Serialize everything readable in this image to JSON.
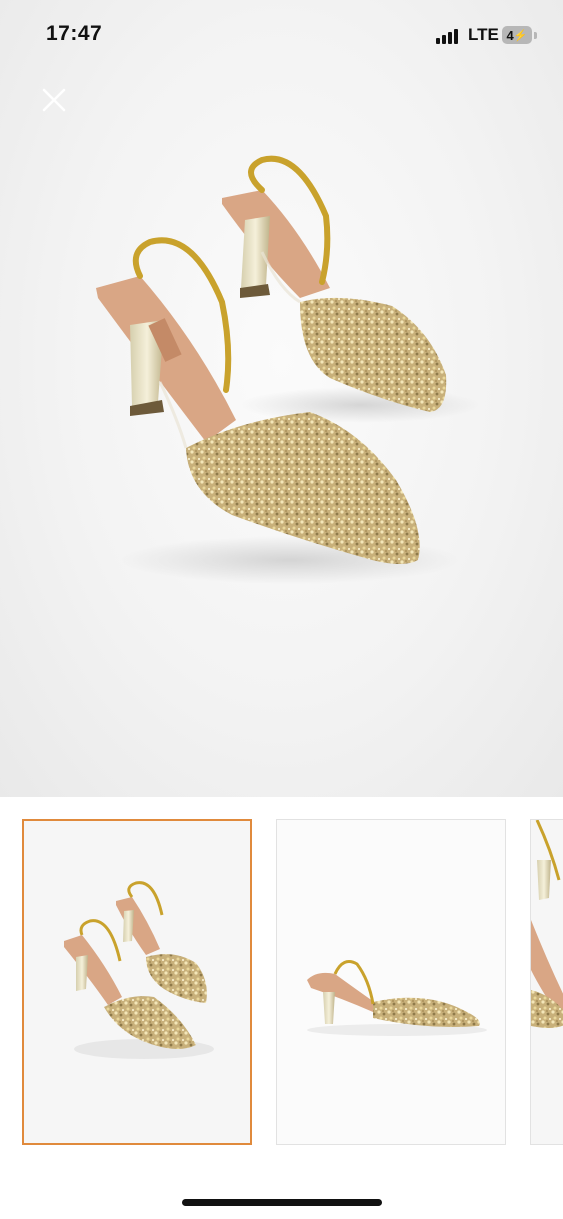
{
  "status_bar": {
    "time": "17:47",
    "network": "LTE",
    "battery": "4"
  },
  "gallery": {
    "close_icon": "close-icon",
    "selected_thumbnail": 1,
    "thumbnails": [
      {
        "view": "pair-angled"
      },
      {
        "view": "single-side"
      },
      {
        "view": "partial-crop"
      }
    ]
  },
  "colors": {
    "accent": "#e08a3c",
    "gold": "#c9a75a",
    "insole": "#d9a685"
  }
}
